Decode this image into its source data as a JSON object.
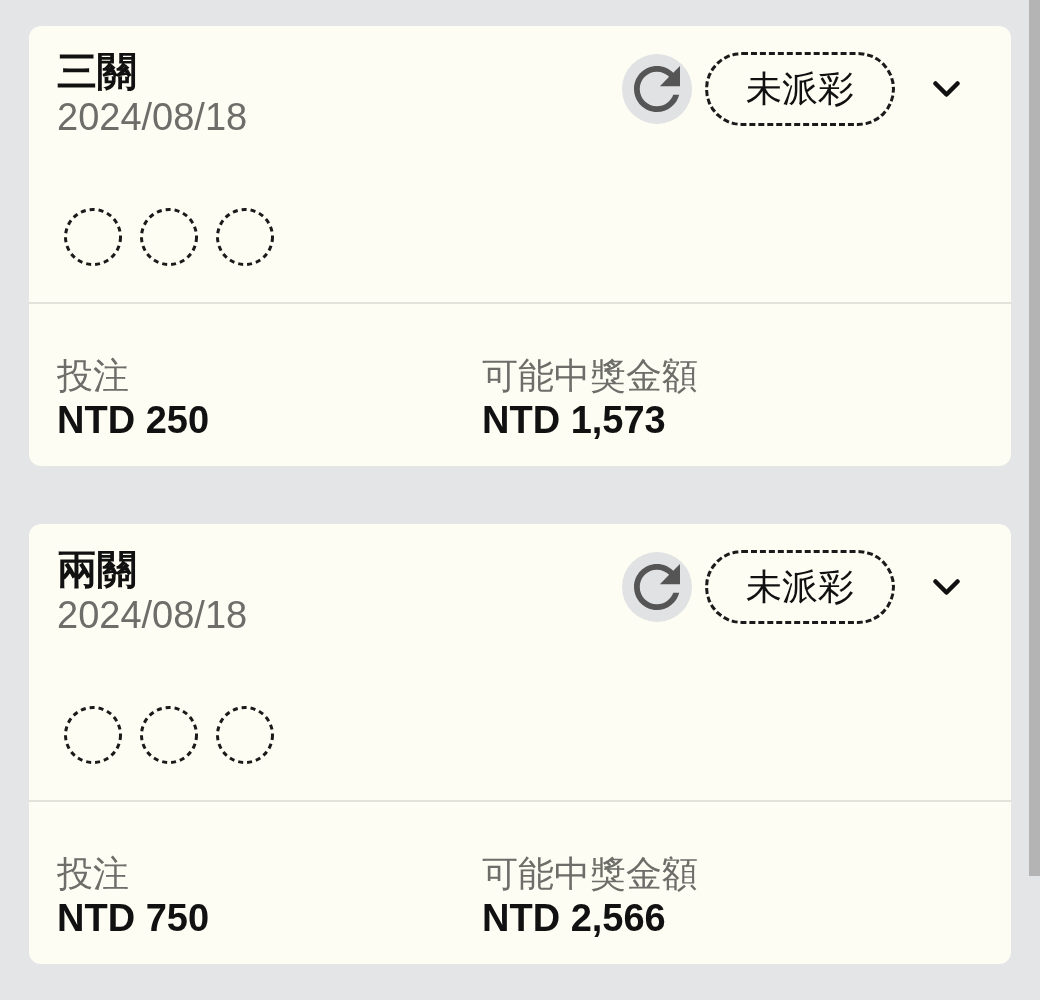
{
  "bets": [
    {
      "title": "三關",
      "date": "2024/08/18",
      "status": "未派彩",
      "expanded": false,
      "legs": [
        {
          "settled": false
        },
        {
          "settled": false
        },
        {
          "settled": false
        }
      ],
      "stake_label": "投注",
      "stake": "NTD 250",
      "payout_label": "可能中獎金額",
      "payout": "NTD 1,573"
    },
    {
      "title": "兩關",
      "date": "2024/08/18",
      "status": "未派彩",
      "expanded": false,
      "legs": [
        {
          "settled": false
        },
        {
          "settled": false
        },
        {
          "settled": false
        }
      ],
      "stake_label": "投注",
      "stake": "NTD 750",
      "payout_label": "可能中獎金額",
      "payout": "NTD 2,566"
    }
  ]
}
